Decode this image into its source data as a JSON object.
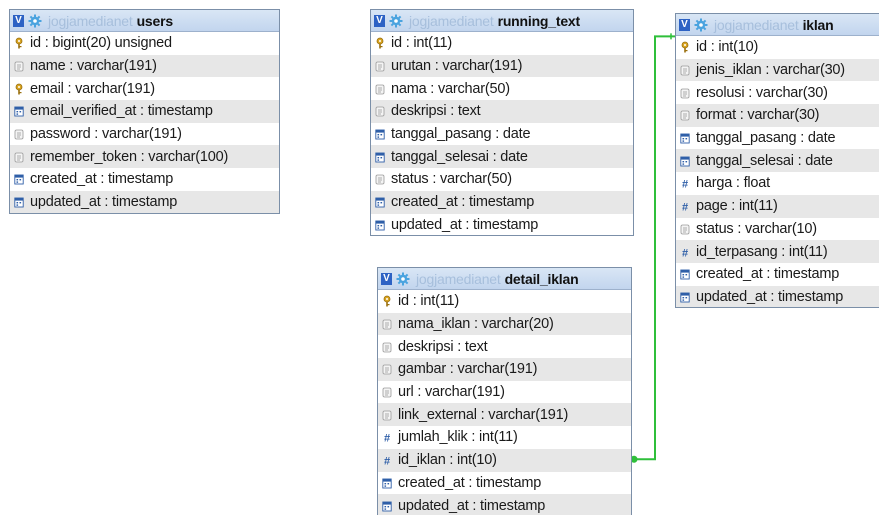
{
  "db_name": "jogjamedianet",
  "colors": {
    "relation_line": "#2fbf3a",
    "header_bg": "#c9daf0",
    "v_badge": "#2d62c4"
  },
  "tables": [
    {
      "id": "users",
      "name": "users",
      "columns": [
        {
          "text": "id : bigint(20) unsigned",
          "icon": "key-icon"
        },
        {
          "text": "name : varchar(191)",
          "icon": "text-field-icon"
        },
        {
          "text": "email : varchar(191)",
          "icon": "key-icon"
        },
        {
          "text": "email_verified_at : timestamp",
          "icon": "calendar-icon"
        },
        {
          "text": "password : varchar(191)",
          "icon": "text-field-icon"
        },
        {
          "text": "remember_token : varchar(100)",
          "icon": "text-field-icon"
        },
        {
          "text": "created_at : timestamp",
          "icon": "calendar-icon"
        },
        {
          "text": "updated_at : timestamp",
          "icon": "calendar-icon"
        }
      ]
    },
    {
      "id": "running_text",
      "name": "running_text",
      "columns": [
        {
          "text": "id : int(11)",
          "icon": "key-icon"
        },
        {
          "text": "urutan : varchar(191)",
          "icon": "text-field-icon"
        },
        {
          "text": "nama : varchar(50)",
          "icon": "text-field-icon"
        },
        {
          "text": "deskripsi : text",
          "icon": "text-field-icon"
        },
        {
          "text": "tanggal_pasang : date",
          "icon": "calendar-icon"
        },
        {
          "text": "tanggal_selesai : date",
          "icon": "calendar-icon"
        },
        {
          "text": "status : varchar(50)",
          "icon": "text-field-icon"
        },
        {
          "text": "created_at : timestamp",
          "icon": "calendar-icon"
        },
        {
          "text": "updated_at : timestamp",
          "icon": "calendar-icon"
        }
      ]
    },
    {
      "id": "iklan",
      "name": "iklan",
      "columns": [
        {
          "text": "id : int(10)",
          "icon": "key-icon"
        },
        {
          "text": "jenis_iklan : varchar(30)",
          "icon": "text-field-icon"
        },
        {
          "text": "resolusi : varchar(30)",
          "icon": "text-field-icon"
        },
        {
          "text": "format : varchar(30)",
          "icon": "text-field-icon"
        },
        {
          "text": "tanggal_pasang : date",
          "icon": "calendar-icon"
        },
        {
          "text": "tanggal_selesai : date",
          "icon": "calendar-icon"
        },
        {
          "text": "harga : float",
          "icon": "hash-icon"
        },
        {
          "text": "page : int(11)",
          "icon": "hash-icon"
        },
        {
          "text": "status : varchar(10)",
          "icon": "text-field-icon"
        },
        {
          "text": "id_terpasang : int(11)",
          "icon": "hash-icon"
        },
        {
          "text": "created_at : timestamp",
          "icon": "calendar-icon"
        },
        {
          "text": "updated_at : timestamp",
          "icon": "calendar-icon"
        }
      ]
    },
    {
      "id": "detail_iklan",
      "name": "detail_iklan",
      "columns": [
        {
          "text": "id : int(11)",
          "icon": "key-icon"
        },
        {
          "text": "nama_iklan : varchar(20)",
          "icon": "text-field-icon"
        },
        {
          "text": "deskripsi : text",
          "icon": "text-field-icon"
        },
        {
          "text": "gambar : varchar(191)",
          "icon": "text-field-icon"
        },
        {
          "text": "url : varchar(191)",
          "icon": "text-field-icon"
        },
        {
          "text": "link_external : varchar(191)",
          "icon": "text-field-icon"
        },
        {
          "text": "jumlah_klik : int(11)",
          "icon": "hash-icon"
        },
        {
          "text": "id_iklan : int(10)",
          "icon": "hash-icon"
        },
        {
          "text": "created_at : timestamp",
          "icon": "calendar-icon"
        },
        {
          "text": "updated_at : timestamp",
          "icon": "calendar-icon"
        }
      ]
    }
  ],
  "relations": [
    {
      "from_table": "detail_iklan",
      "from_column": "id_iklan",
      "to_table": "iklan",
      "to_column": "id"
    }
  ]
}
